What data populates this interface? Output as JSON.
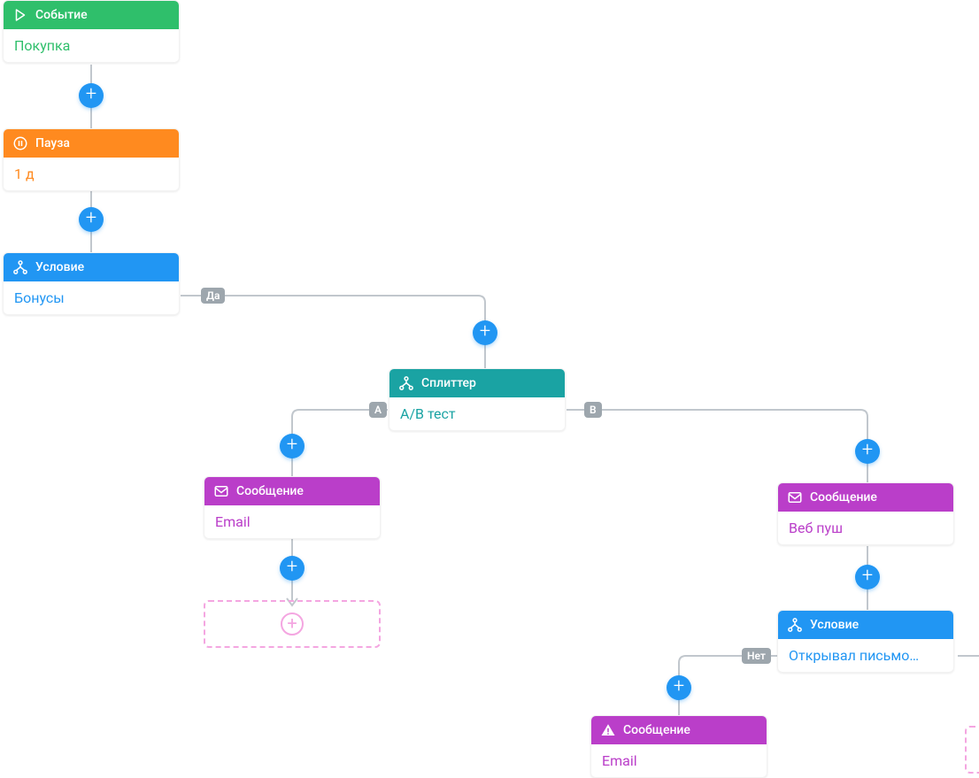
{
  "nodes": {
    "event": {
      "title": "Событие",
      "value": "Покупка"
    },
    "pause": {
      "title": "Пауза",
      "value": "1 д"
    },
    "cond": {
      "title": "Условие",
      "value": "Бонусы"
    },
    "split": {
      "title": "Сплиттер",
      "value": "A/B тест"
    },
    "msgA": {
      "title": "Сообщение",
      "value": "Email"
    },
    "msgB": {
      "title": "Сообщение",
      "value": "Веб пуш"
    },
    "cond2": {
      "title": "Условие",
      "value": "Открывал письмо…"
    },
    "msgC": {
      "title": "Сообщение",
      "value": "Email"
    }
  },
  "badges": {
    "yes": "Да",
    "no": "Нет",
    "a": "A",
    "b": "B"
  },
  "colors": {
    "event": "#2fbf6b",
    "pause": "#ff8a1f",
    "cond": "#2196f3",
    "split": "#1aa3a3",
    "msg": "#ba3ec9",
    "plus": "#2196f3",
    "wire": "#c1c7cd",
    "badge": "#9da6ad"
  }
}
